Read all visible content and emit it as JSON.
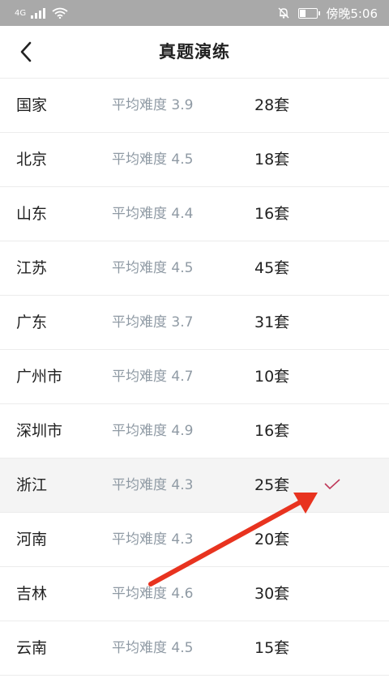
{
  "status_bar": {
    "network": "4G",
    "time": "傍晚5:06",
    "battery_level": 0.35
  },
  "header": {
    "title": "真题演练"
  },
  "rows": [
    {
      "name": "国家",
      "difficulty": "平均难度 3.9",
      "count": "28套",
      "selected": false
    },
    {
      "name": "北京",
      "difficulty": "平均难度 4.5",
      "count": "18套",
      "selected": false
    },
    {
      "name": "山东",
      "difficulty": "平均难度 4.4",
      "count": "16套",
      "selected": false
    },
    {
      "name": "江苏",
      "difficulty": "平均难度 4.5",
      "count": "45套",
      "selected": false
    },
    {
      "name": "广东",
      "difficulty": "平均难度 3.7",
      "count": "31套",
      "selected": false
    },
    {
      "name": "广州市",
      "difficulty": "平均难度 4.7",
      "count": "10套",
      "selected": false
    },
    {
      "name": "深圳市",
      "difficulty": "平均难度 4.9",
      "count": "16套",
      "selected": false
    },
    {
      "name": "浙江",
      "difficulty": "平均难度 4.3",
      "count": "25套",
      "selected": true
    },
    {
      "name": "河南",
      "difficulty": "平均难度 4.3",
      "count": "20套",
      "selected": false
    },
    {
      "name": "吉林",
      "difficulty": "平均难度 4.6",
      "count": "30套",
      "selected": false
    },
    {
      "name": "云南",
      "difficulty": "平均难度 4.5",
      "count": "15套",
      "selected": false
    }
  ],
  "colors": {
    "check_mark": "#c0395a",
    "annotation_arrow": "#e8331f",
    "status_bar_bg": "#a9a9a9"
  }
}
